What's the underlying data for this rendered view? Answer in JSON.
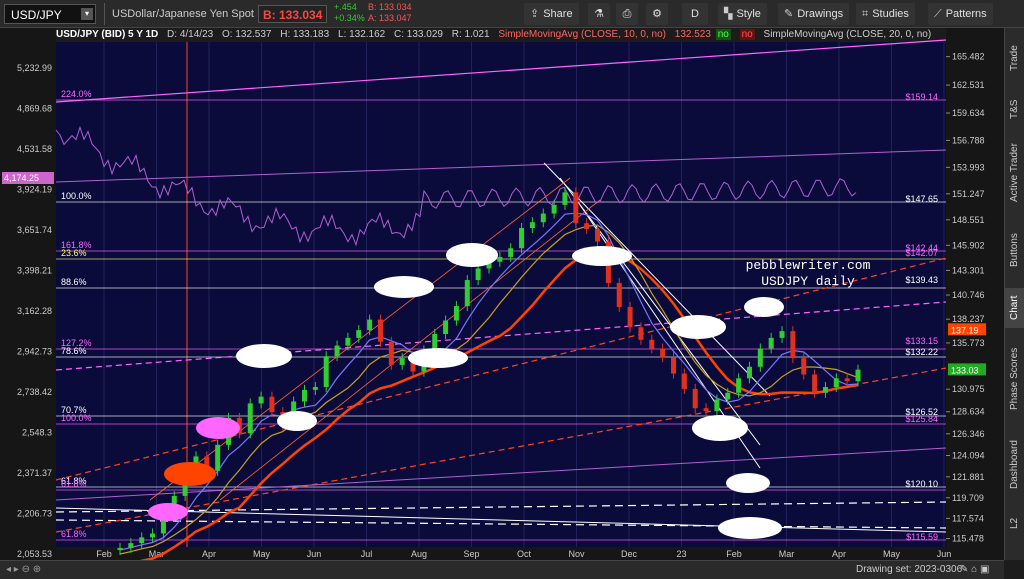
{
  "toolbar": {
    "symbol": "USD/JPY",
    "description": "USDollar/Japanese Yen Spot",
    "bid_label": "B: 133.034",
    "change": "+.454",
    "change_pct": "+0.34%",
    "bid_small": "B: 133.034",
    "ask_small": "A: 133.047",
    "share": "Share",
    "period": "D",
    "style": "Style",
    "drawings": "Drawings",
    "studies": "Studies",
    "patterns": "Patterns"
  },
  "header": {
    "title": "USD/JPY (BID) 5 Y 1D",
    "date": "D: 4/14/23",
    "open": "O: 132.537",
    "high": "H: 133.183",
    "low": "L: 132.162",
    "close": "C: 133.029",
    "range": "R: 1.021",
    "sma10": "SimpleMovingAvg (CLOSE, 10, 0, no)",
    "sma10_val": "132.523",
    "flag_no1": "no",
    "flag_no2": "no",
    "sma20": "SimpleMovingAvg (CLOSE, 20, 0, no)"
  },
  "sidebar": {
    "tabs": [
      "Trade",
      "T&S",
      "Active Trader",
      "Buttons",
      "Chart",
      "Phase Scores",
      "Dashboard",
      "L2"
    ],
    "active": "Chart"
  },
  "bottom": {
    "drawing_set": "Drawing set: 2023-0306"
  },
  "chart_data": {
    "type": "candlestick",
    "title": "USD/JPY (BID) 5 Y 1D",
    "watermark": "pebblewriter.com\nUSDJPY daily",
    "colors": {
      "background": "#0b0b3b",
      "candle_up": "#32cd32",
      "candle_down": "#e03020",
      "sma_fast": "#ff9933",
      "sma_slow": "#9966ff",
      "overlay_index": "#b060d0",
      "fib_line": "#ffffff",
      "fib_pink": "#ff66ff"
    },
    "x_axis_labels": [
      "Feb",
      "Mar",
      "Apr",
      "May",
      "Jun",
      "Jul",
      "Aug",
      "Sep",
      "Oct",
      "Nov",
      "Dec",
      "23",
      "Feb",
      "Mar",
      "Apr",
      "May",
      "Jun"
    ],
    "right_axis": {
      "ticks": [
        165.482,
        162.531,
        159.634,
        156.788,
        153.993,
        151.247,
        148.551,
        145.902,
        143.301,
        140.746,
        138.237,
        135.773,
        130.975,
        128.634,
        126.346,
        124.094,
        121.881,
        119.709,
        117.574,
        115.478
      ],
      "price_tags": [
        {
          "value": "137.19",
          "color": "#ff4400"
        },
        {
          "value": "133.03",
          "color": "#22aa22"
        }
      ]
    },
    "left_axis": {
      "ticks": [
        "5,232.99",
        "4,869.68",
        "4,531.58",
        "3,924.19",
        "3,651.74",
        "3,398.21",
        "3,162.28",
        "2,942.73",
        "2,738.42",
        "2,548.3",
        "2,371.37",
        "2,206.73",
        "2,053.53"
      ],
      "tag": "4,174.25"
    },
    "fib_levels_left": [
      "224.0%",
      "100.0%",
      "161.8%",
      "23.6%",
      "88.6%",
      "127.2%",
      "78.6%",
      "70.7%",
      "100.0%",
      "61.8%",
      "61.8%",
      "61.8%"
    ],
    "fib_levels_right": [
      "$159.14",
      "$147.65",
      "$142.44",
      "$142.07",
      "$139.43",
      "$133.15",
      "$132.22",
      "$126.52",
      "$125.84",
      "$120.10",
      "$115.59"
    ],
    "series": [
      {
        "name": "USD/JPY daily",
        "ohlc_close": [
          114.5,
          115.0,
          115.6,
          116.0,
          117.8,
          119.9,
          121.8,
          124.0,
          122.5,
          125.2,
          128.0,
          126.4,
          129.5,
          130.2,
          128.6,
          127.2,
          129.7,
          130.9,
          131.2,
          134.4,
          135.5,
          136.3,
          137.1,
          138.2,
          135.9,
          133.5,
          134.2,
          132.8,
          135.0,
          136.7,
          138.1,
          139.6,
          142.3,
          143.5,
          144.2,
          144.7,
          145.6,
          147.7,
          148.3,
          149.2,
          150.1,
          151.4,
          148.2,
          147.6,
          146.3,
          142.0,
          139.5,
          137.4,
          136.1,
          135.2,
          134.3,
          132.6,
          131.0,
          129.0,
          128.7,
          129.9,
          130.6,
          132.1,
          133.3,
          135.2,
          136.3,
          137.0,
          134.2,
          132.5,
          130.6,
          131.2,
          132.1,
          131.8,
          133.0
        ]
      }
    ]
  }
}
